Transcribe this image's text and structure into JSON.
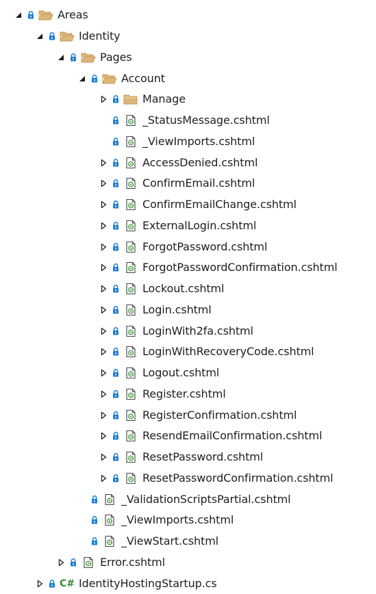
{
  "tree": {
    "nodes": [
      {
        "label": "Areas",
        "depth": 0,
        "arrow": "expanded",
        "type": "folder-open"
      },
      {
        "label": "Identity",
        "depth": 1,
        "arrow": "expanded",
        "type": "folder-open"
      },
      {
        "label": "Pages",
        "depth": 2,
        "arrow": "expanded",
        "type": "folder-open"
      },
      {
        "label": "Account",
        "depth": 3,
        "arrow": "expanded",
        "type": "folder-open"
      },
      {
        "label": "Manage",
        "depth": 4,
        "arrow": "collapsed",
        "type": "folder"
      },
      {
        "label": "_StatusMessage.cshtml",
        "depth": 4,
        "arrow": "none",
        "type": "cshtml"
      },
      {
        "label": "_ViewImports.cshtml",
        "depth": 4,
        "arrow": "none",
        "type": "cshtml"
      },
      {
        "label": "AccessDenied.cshtml",
        "depth": 4,
        "arrow": "collapsed",
        "type": "cshtml"
      },
      {
        "label": "ConfirmEmail.cshtml",
        "depth": 4,
        "arrow": "collapsed",
        "type": "cshtml"
      },
      {
        "label": "ConfirmEmailChange.cshtml",
        "depth": 4,
        "arrow": "collapsed",
        "type": "cshtml"
      },
      {
        "label": "ExternalLogin.cshtml",
        "depth": 4,
        "arrow": "collapsed",
        "type": "cshtml"
      },
      {
        "label": "ForgotPassword.cshtml",
        "depth": 4,
        "arrow": "collapsed",
        "type": "cshtml"
      },
      {
        "label": "ForgotPasswordConfirmation.cshtml",
        "depth": 4,
        "arrow": "collapsed",
        "type": "cshtml"
      },
      {
        "label": "Lockout.cshtml",
        "depth": 4,
        "arrow": "collapsed",
        "type": "cshtml"
      },
      {
        "label": "Login.cshtml",
        "depth": 4,
        "arrow": "collapsed",
        "type": "cshtml"
      },
      {
        "label": "LoginWith2fa.cshtml",
        "depth": 4,
        "arrow": "collapsed",
        "type": "cshtml"
      },
      {
        "label": "LoginWithRecoveryCode.cshtml",
        "depth": 4,
        "arrow": "collapsed",
        "type": "cshtml"
      },
      {
        "label": "Logout.cshtml",
        "depth": 4,
        "arrow": "collapsed",
        "type": "cshtml"
      },
      {
        "label": "Register.cshtml",
        "depth": 4,
        "arrow": "collapsed",
        "type": "cshtml"
      },
      {
        "label": "RegisterConfirmation.cshtml",
        "depth": 4,
        "arrow": "collapsed",
        "type": "cshtml"
      },
      {
        "label": "ResendEmailConfirmation.cshtml",
        "depth": 4,
        "arrow": "collapsed",
        "type": "cshtml"
      },
      {
        "label": "ResetPassword.cshtml",
        "depth": 4,
        "arrow": "collapsed",
        "type": "cshtml"
      },
      {
        "label": "ResetPasswordConfirmation.cshtml",
        "depth": 4,
        "arrow": "collapsed",
        "type": "cshtml"
      },
      {
        "label": "_ValidationScriptsPartial.cshtml",
        "depth": 3,
        "arrow": "none",
        "type": "cshtml"
      },
      {
        "label": "_ViewImports.cshtml",
        "depth": 3,
        "arrow": "none",
        "type": "cshtml"
      },
      {
        "label": "_ViewStart.cshtml",
        "depth": 3,
        "arrow": "none",
        "type": "cshtml"
      },
      {
        "label": "Error.cshtml",
        "depth": 2,
        "arrow": "collapsed",
        "type": "cshtml"
      },
      {
        "label": "IdentityHostingStartup.cs",
        "depth": 1,
        "arrow": "collapsed",
        "type": "csharp",
        "type_glyph": "C#"
      }
    ]
  },
  "colors": {
    "text": "#1e1e1e",
    "lock": "#1b7fd6",
    "folder": "#dcb67a",
    "file_border": "#424242",
    "file_accent": "#388a34",
    "csharp": "#388a34"
  }
}
